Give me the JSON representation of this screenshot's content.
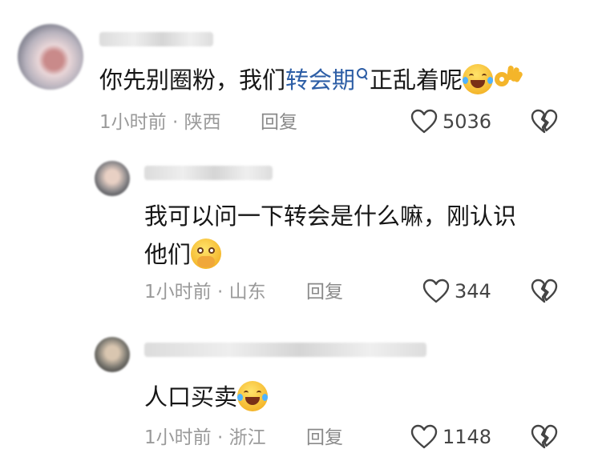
{
  "comments": [
    {
      "level": "top",
      "text_before_link": "你先别圈粉，我们",
      "link_text": "转会期",
      "text_after_link": "正乱着呢",
      "emojis": [
        "rofl-emoji",
        "ok-hand-emoji"
      ],
      "time": "1小时前",
      "separator": "·",
      "location": "陕西",
      "reply_label": "回复",
      "likes": "5036"
    },
    {
      "level": "reply",
      "text_line1": "我可以问一下转会是什么嘛，刚认识",
      "text_line2": "他们",
      "emojis": [
        "pleading-emoji"
      ],
      "time": "1小时前",
      "separator": "·",
      "location": "山东",
      "reply_label": "回复",
      "likes": "344"
    },
    {
      "level": "reply",
      "text": "人口买卖",
      "emojis": [
        "joy-emoji"
      ],
      "time": "1小时前",
      "separator": "·",
      "location": "浙江",
      "reply_label": "回复",
      "likes": "1148"
    }
  ],
  "colors": {
    "link": "#2d5ea6",
    "meta": "#9a9a9a",
    "text": "#161616"
  }
}
